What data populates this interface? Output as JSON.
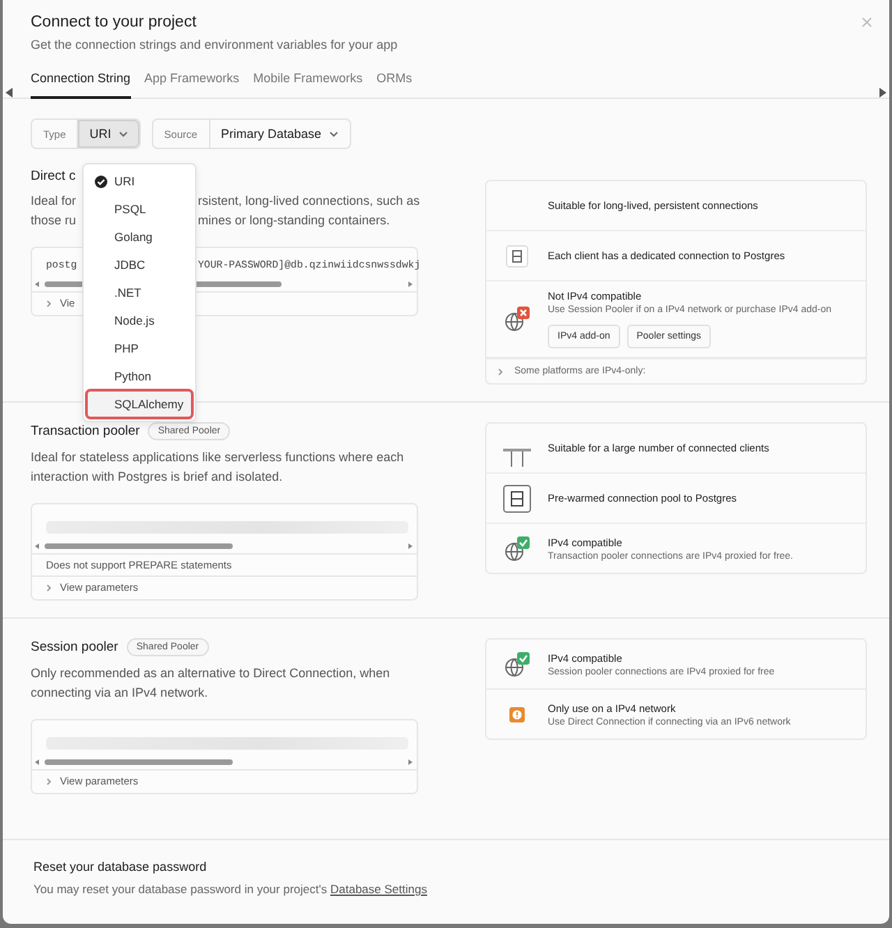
{
  "dialog": {
    "title": "Connect to your project",
    "subtitle": "Get the connection strings and environment variables for your app"
  },
  "tabs": [
    {
      "label": "Connection String",
      "selected": true
    },
    {
      "label": "App Frameworks",
      "selected": false
    },
    {
      "label": "Mobile Frameworks",
      "selected": false
    },
    {
      "label": "ORMs",
      "selected": false
    }
  ],
  "selects": [
    {
      "label": "Type",
      "value": "URI",
      "open": true
    },
    {
      "label": "Source",
      "value": "Primary Database",
      "open": false
    }
  ],
  "type_menu": [
    {
      "label": "URI",
      "selected": true,
      "highlighted": false
    },
    {
      "label": "PSQL",
      "selected": false,
      "highlighted": false
    },
    {
      "label": "Golang",
      "selected": false,
      "highlighted": false
    },
    {
      "label": "JDBC",
      "selected": false,
      "highlighted": false
    },
    {
      "label": ".NET",
      "selected": false,
      "highlighted": false
    },
    {
      "label": "Node.js",
      "selected": false,
      "highlighted": false
    },
    {
      "label": "PHP",
      "selected": false,
      "highlighted": false
    },
    {
      "label": "Python",
      "selected": false,
      "highlighted": false
    },
    {
      "label": "SQLAlchemy",
      "selected": false,
      "highlighted": true
    }
  ],
  "direct_connection": {
    "title": "Direct c",
    "description": [
      {
        "left": "Ideal for",
        "right": "rsistent, long-lived connections, such as"
      },
      {
        "left": "those ru",
        "right": "mines or long-standing containers."
      }
    ],
    "code": {
      "left": "postg",
      "right": "YOUR-PASSWORD]@db.qzinwiidcsnwssdwkj"
    },
    "params": "Vie",
    "features": [
      {
        "kind": "blank",
        "title": "Suitable for long-lived, persistent connections"
      },
      {
        "kind": "server",
        "title": "Each client has a dedicated connection to Postgres"
      },
      {
        "kind": "globe-error",
        "title": "Not IPv4 compatible",
        "description": "Use Session Pooler if on a IPv4 network or purchase IPv4 add-on",
        "buttons": [
          "IPv4 add-on",
          "Pooler settings"
        ]
      }
    ],
    "footer": "Some platforms are IPv4-only:"
  },
  "poolers": [
    {
      "title": "Transaction pooler",
      "badge": "Shared Pooler",
      "description": "Ideal for stateless applications like serverless functions where each interaction with Postgres is brief and isolated.",
      "note": "Does not support PREPARE statements",
      "params": "View parameters",
      "features": [
        {
          "kind": "pool-bar",
          "title": "Suitable for a large number of connected clients"
        },
        {
          "kind": "pool-server",
          "title": "Pre-warmed connection pool to Postgres"
        },
        {
          "kind": "globe-ok",
          "title": "IPv4 compatible",
          "description": "Transaction pooler connections are IPv4 proxied for free."
        }
      ]
    },
    {
      "title": "Session pooler",
      "badge": "Shared Pooler",
      "description": "Only recommended as an alternative to Direct Connection, when connecting via an IPv4 network.",
      "params": "View parameters",
      "features": [
        {
          "kind": "globe-ok",
          "title": "IPv4 compatible",
          "description": "Session pooler connections are IPv4 proxied for free"
        },
        {
          "kind": "warning",
          "title": "Only use on a IPv4 network",
          "description": "Use Direct Connection if connecting via an IPv6 network"
        }
      ]
    }
  ],
  "reset": {
    "title": "Reset your database password",
    "text": "You may reset your database password in your project's ",
    "link": "Database Settings"
  }
}
